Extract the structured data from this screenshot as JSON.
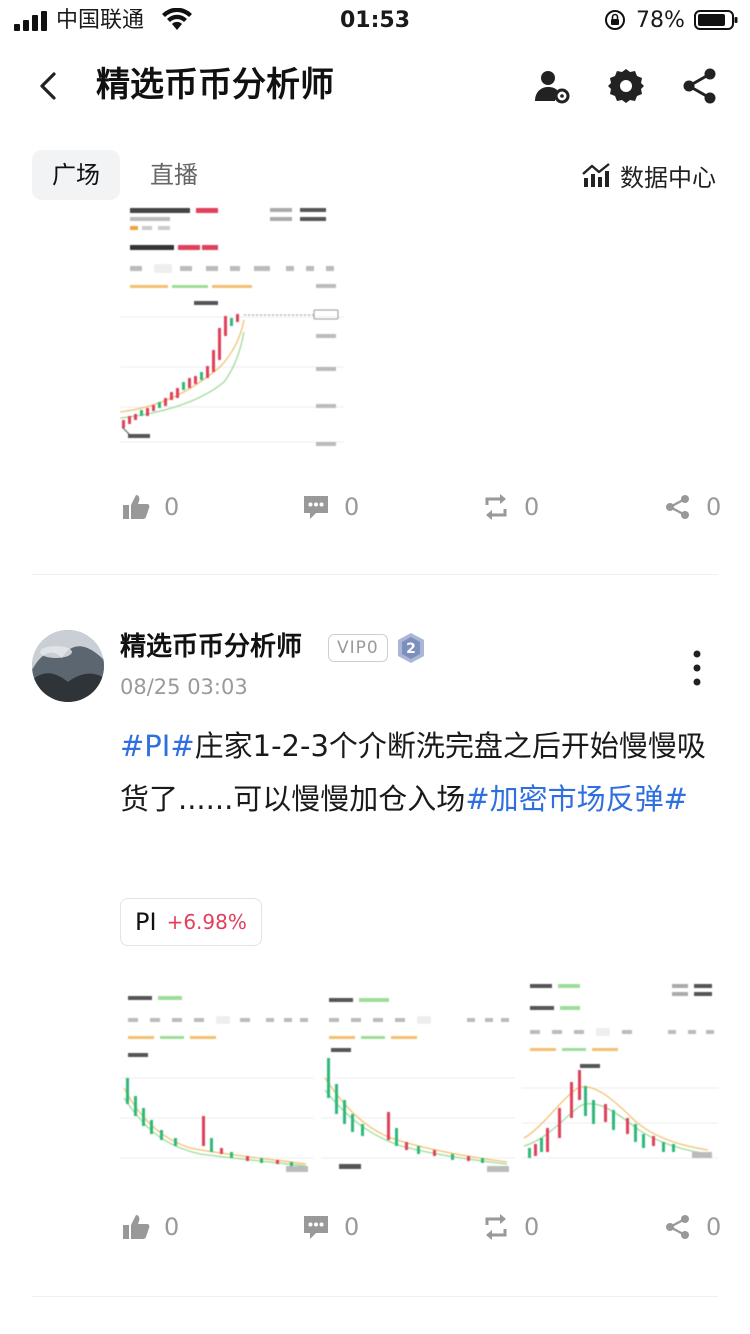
{
  "status_bar": {
    "carrier": "中国联通",
    "time": "01:53",
    "battery": "78%"
  },
  "nav": {
    "title": "精选币币分析师",
    "icons": [
      "back-icon",
      "user-settings-icon",
      "gear-icon",
      "share-icon"
    ]
  },
  "tabs": {
    "items": [
      "广场",
      "直播"
    ],
    "active": "广场",
    "data_center": "数据中心"
  },
  "post1": {
    "actions": {
      "like": "0",
      "comment": "0",
      "repost": "0",
      "share": "0"
    }
  },
  "post2": {
    "author": "精选币币分析师",
    "vip": "VIP0",
    "level": "2",
    "time": "08/25 03:03",
    "text": {
      "topic1": "#PI#",
      "body": "庄家1-2-3个介断洗完盘之后开始慢慢吸货了......可以慢慢加仓入场",
      "topic2": "#加密市场反弹#"
    },
    "coin": {
      "name": "PI",
      "change": "+6.98%"
    },
    "actions": {
      "like": "0",
      "comment": "0",
      "repost": "0",
      "share": "0"
    }
  },
  "colors": {
    "topic": "#2f6fe0",
    "change_up": "#e0405a",
    "candle_up": "#e0405a",
    "candle_down": "#2fb87a"
  }
}
